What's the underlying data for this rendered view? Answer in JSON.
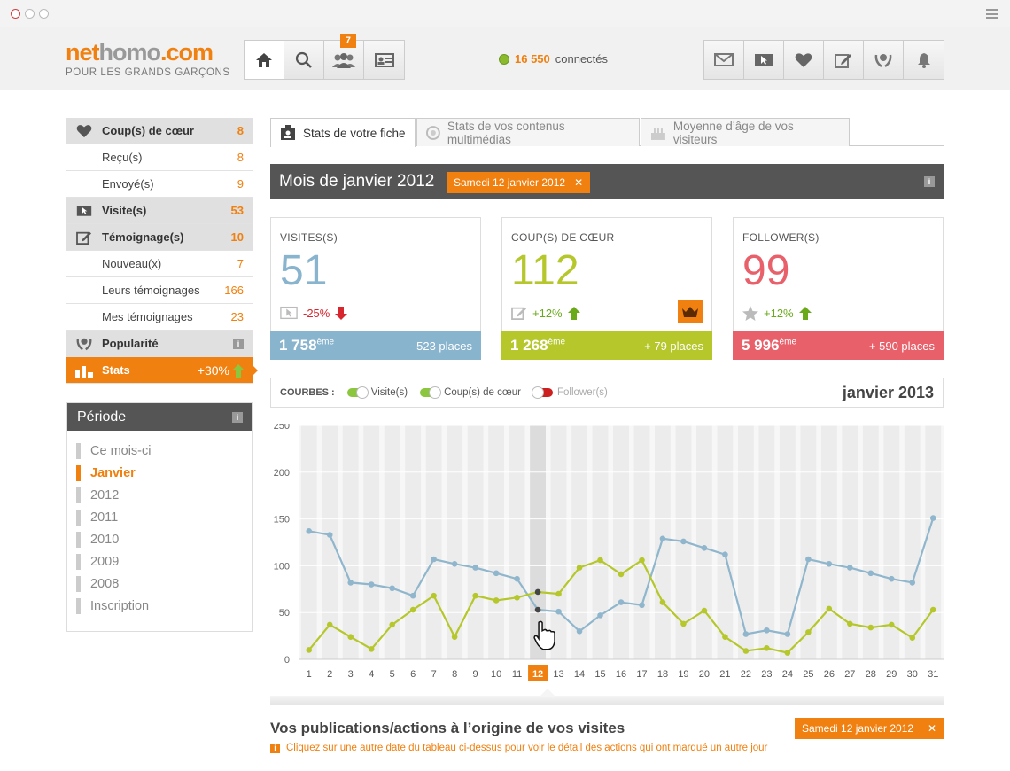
{
  "brand": {
    "logo_a": "net",
    "logo_b": "homo",
    "logo_c": ".com",
    "tagline": "POUR LES GRANDS GARÇONS"
  },
  "nav": {
    "friends_badge": "7"
  },
  "online": {
    "count": "16 550",
    "label": "connectés"
  },
  "sidebar": {
    "coups": {
      "label": "Coup(s) de cœur",
      "count": "8"
    },
    "recus": {
      "label": "Reçu(s)",
      "count": "8"
    },
    "envoyes": {
      "label": "Envoyé(s)",
      "count": "9"
    },
    "visites": {
      "label": "Visite(s)",
      "count": "53"
    },
    "temoignages": {
      "label": "Témoignage(s)",
      "count": "10"
    },
    "nouveaux": {
      "label": "Nouveau(x)",
      "count": "7"
    },
    "leurs": {
      "label": "Leurs témoignages",
      "count": "166"
    },
    "mes": {
      "label": "Mes témoignages",
      "count": "23"
    },
    "popularite": {
      "label": "Popularité"
    },
    "stats": {
      "label": "Stats",
      "count": "+30%"
    }
  },
  "period": {
    "title": "Période",
    "items": [
      "Ce mois-ci",
      "Janvier",
      "2012",
      "2011",
      "2010",
      "2009",
      "2008",
      "Inscription"
    ],
    "active": "Janvier"
  },
  "tabs": [
    "Stats de votre fiche",
    "Stats de vos contenus multimédias",
    "Moyenne d’âge de vos visiteurs"
  ],
  "month": {
    "title": "Mois de janvier 2012",
    "date": "Samedi 12 janvier 2012"
  },
  "cards": [
    {
      "label": "VISITES(S)",
      "value": "51",
      "delta": "-25%",
      "rank": "1 758",
      "sup": "ème",
      "places": "- 523 places",
      "color": "#89b4cd"
    },
    {
      "label": "COUP(S) DE CŒUR",
      "value": "112",
      "delta": "+12%",
      "rank": "1 268",
      "sup": "ème",
      "places": "+ 79 places",
      "color": "#b5c72b"
    },
    {
      "label": "FOLLOWER(S)",
      "value": "99",
      "delta": "+12%",
      "rank": "5 996",
      "sup": "ème",
      "places": "+ 590 places",
      "color": "#e8606a"
    }
  ],
  "courbes": {
    "label": "COURBES :",
    "visites": "Visite(s)",
    "coups": "Coup(s) de cœur",
    "followers": "Follower(s)",
    "period": "janvier 2013"
  },
  "chart_data": {
    "type": "line",
    "x": [
      1,
      2,
      3,
      4,
      5,
      6,
      7,
      8,
      9,
      10,
      11,
      12,
      13,
      14,
      15,
      16,
      17,
      18,
      19,
      20,
      21,
      22,
      23,
      24,
      25,
      26,
      27,
      28,
      29,
      30,
      31
    ],
    "ylim": [
      0,
      250
    ],
    "yticks": [
      0,
      50,
      100,
      150,
      200,
      250
    ],
    "highlight_x": 12,
    "series": [
      {
        "name": "Visite(s)",
        "color": "#8fb6cc",
        "values": [
          137,
          133,
          82,
          80,
          76,
          68,
          107,
          102,
          98,
          92,
          86,
          53,
          51,
          30,
          47,
          61,
          58,
          129,
          126,
          119,
          112,
          27,
          31,
          27,
          107,
          102,
          98,
          92,
          86,
          82,
          151
        ]
      },
      {
        "name": "Coup(s) de cœur",
        "color": "#b5c72b",
        "values": [
          10,
          37,
          24,
          11,
          37,
          53,
          68,
          24,
          68,
          63,
          66,
          72,
          70,
          98,
          106,
          91,
          106,
          61,
          38,
          52,
          24,
          9,
          12,
          7,
          29,
          54,
          38,
          34,
          37,
          23,
          53
        ]
      }
    ]
  },
  "pubs": {
    "title": "Vos publications/actions à l’origine de vos visites",
    "date": "Samedi 12 janvier 2012",
    "note": "Cliquez sur une autre date du tableau ci-dessus pour voir le détail des actions qui ont marqué un autre jour"
  }
}
